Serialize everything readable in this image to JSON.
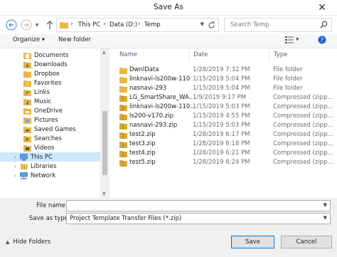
{
  "window": {
    "title": "Save As"
  },
  "address": {
    "crumbs": [
      "This PC",
      "Data (D:)",
      "Temp"
    ]
  },
  "search": {
    "placeholder": "Search Temp"
  },
  "toolbar": {
    "organize": "Organize ▾",
    "new_folder": "New folder"
  },
  "sidebar": {
    "items": [
      {
        "label": "Documents",
        "icon": "documents-icon"
      },
      {
        "label": "Downloads",
        "icon": "downloads-icon"
      },
      {
        "label": "Dropbox",
        "icon": "dropbox-icon"
      },
      {
        "label": "Favorites",
        "icon": "favorites-icon"
      },
      {
        "label": "Links",
        "icon": "links-icon"
      },
      {
        "label": "Music",
        "icon": "music-icon"
      },
      {
        "label": "OneDrive",
        "icon": "onedrive-icon"
      },
      {
        "label": "Pictures",
        "icon": "pictures-icon"
      },
      {
        "label": "Saved Games",
        "icon": "saved-games-icon"
      },
      {
        "label": "Searches",
        "icon": "searches-icon"
      },
      {
        "label": "Videos",
        "icon": "videos-icon"
      },
      {
        "label": "This PC",
        "icon": "this-pc-icon"
      },
      {
        "label": "Libraries",
        "icon": "libraries-icon"
      },
      {
        "label": "Network",
        "icon": "network-icon"
      }
    ]
  },
  "columns": {
    "name": "Name",
    "date": "Date",
    "type": "Type"
  },
  "files": [
    {
      "name": "DwnlData",
      "date": "1/28/2019 7:32 PM",
      "type": "File folder",
      "kind": "folder"
    },
    {
      "name": "linknavi-ls200w-110",
      "date": "1/15/2019 5:04 PM",
      "type": "File folder",
      "kind": "folder"
    },
    {
      "name": "nasnavi-293",
      "date": "1/15/2019 5:04 PM",
      "type": "File folder",
      "kind": "folder"
    },
    {
      "name": "LG_SmartShare_WA...",
      "date": "1/9/2019 9:17 PM",
      "type": "Compressed (zipp...",
      "kind": "zip"
    },
    {
      "name": "linknavi-ls200w-110...",
      "date": "1/15/2019 5:03 PM",
      "type": "Compressed (zipp...",
      "kind": "zip"
    },
    {
      "name": "ls200-v170.zip",
      "date": "1/15/2019 4:55 PM",
      "type": "Compressed (zipp...",
      "kind": "zip"
    },
    {
      "name": "nasnavi-293.zip",
      "date": "1/15/2019 5:03 PM",
      "type": "Compressed (zipp...",
      "kind": "zip"
    },
    {
      "name": "test2.zip",
      "date": "1/28/2019 6:17 PM",
      "type": "Compressed (zipp...",
      "kind": "zip"
    },
    {
      "name": "test3.zip",
      "date": "1/28/2019 6:18 PM",
      "type": "Compressed (zipp...",
      "kind": "zip"
    },
    {
      "name": "test4.zip",
      "date": "1/28/2019 6:21 PM",
      "type": "Compressed (zipp...",
      "kind": "zip"
    },
    {
      "name": "test5.zip",
      "date": "1/28/2019 6:24 PM",
      "type": "Compressed (zipp...",
      "kind": "zip"
    }
  ],
  "form": {
    "file_name_label": "File name:",
    "file_name_value": "",
    "save_as_type_label": "Save as type:",
    "save_as_type_value": "Project Template Transfer Files (*.zip)"
  },
  "footer": {
    "hide_folders": "Hide Folders",
    "save": "Save",
    "cancel": "Cancel"
  },
  "colors": {
    "accent": "#0078d7",
    "selection": "#cce8ff",
    "folder": "#e8b746",
    "zip": "#d9a838"
  }
}
